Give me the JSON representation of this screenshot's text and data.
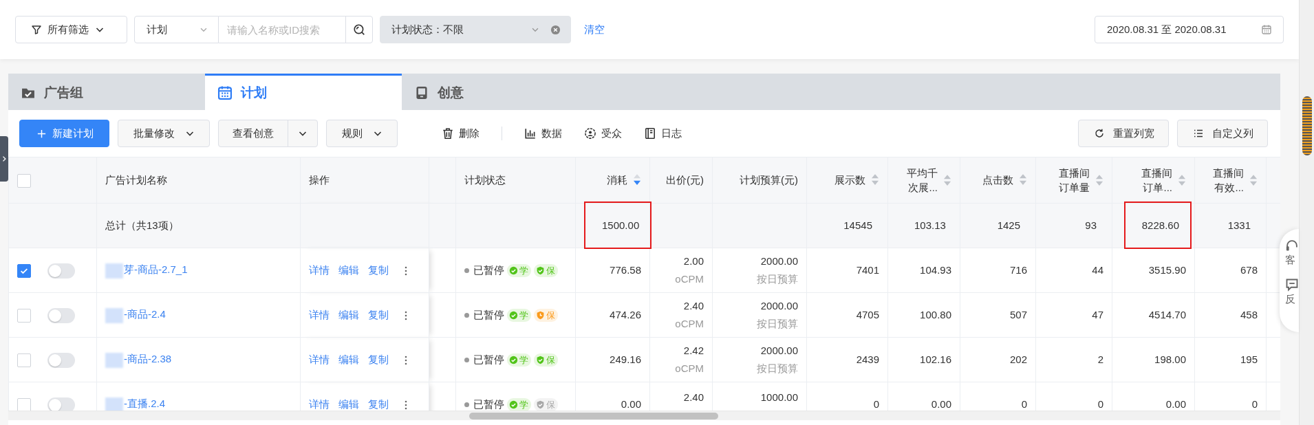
{
  "filters": {
    "scope": "所有筛选",
    "type": "计划",
    "search_placeholder": "请输入名称或ID搜索",
    "status": "计划状态：不限",
    "clear": "清空",
    "date_range": "2020.08.31 至 2020.08.31"
  },
  "tabs": [
    {
      "label": "广告组",
      "selected": false
    },
    {
      "label": "计划",
      "selected": true
    },
    {
      "label": "创意",
      "selected": false
    }
  ],
  "toolbar": {
    "buttons": [
      {
        "label": "新建计划",
        "kind": "primary"
      },
      {
        "label": "批量修改",
        "kind": "dropdown"
      },
      {
        "label": "查看创意",
        "kind": "split"
      },
      {
        "label": "规则",
        "kind": "dropdown"
      }
    ],
    "actions": [
      "删除",
      "数据",
      "受众",
      "日志"
    ],
    "right_buttons": [
      "重置列宽",
      "自定义列"
    ]
  },
  "table": {
    "header_checkbox": {
      "checked": false
    },
    "columns": [
      {
        "lines": [
          "广告计划名称"
        ],
        "sortable": false
      },
      {
        "lines": [
          "操作"
        ],
        "sortable": false
      },
      {
        "lines": [
          "计划状态"
        ],
        "sortable": false
      },
      {
        "lines": [
          "消耗"
        ],
        "sortable": true,
        "sorted_desc": true
      },
      {
        "lines": [
          "出价(元)"
        ],
        "sortable": false
      },
      {
        "lines": [
          "计划预算(元)"
        ],
        "sortable": false
      },
      {
        "lines": [
          "展示数"
        ],
        "sortable": true,
        "sorted_desc": false
      },
      {
        "lines": [
          "平均千",
          "次展..."
        ],
        "sortable": true,
        "sorted_desc": false
      },
      {
        "lines": [
          "点击数"
        ],
        "sortable": true,
        "sorted_desc": false
      },
      {
        "lines": [
          "直播间",
          "订单量"
        ],
        "sortable": true,
        "sorted_desc": false
      },
      {
        "lines": [
          "直播间",
          "订单..."
        ],
        "sortable": true,
        "sorted_desc": false
      },
      {
        "lines": [
          "直播间",
          "有效..."
        ],
        "sortable": true,
        "sorted_desc": false
      }
    ],
    "totals": {
      "label": "总计（共13项）",
      "cells": [
        {
          "value": "1500.00",
          "highlighted": true
        },
        null,
        null,
        {
          "value": "14545",
          "highlighted": false
        },
        {
          "value": "103.13",
          "highlighted": false
        },
        {
          "value": "1425",
          "highlighted": false
        },
        {
          "value": "93",
          "highlighted": false
        },
        {
          "value": "8228.60",
          "highlighted": true
        },
        {
          "value": "1331",
          "highlighted": false
        }
      ]
    },
    "rows": [
      {
        "checked": true,
        "on": false,
        "name": "芽-商品-2.7_1",
        "actions": [
          "详情",
          "编辑",
          "复制"
        ],
        "status": "已暂停",
        "badges": [
          {
            "label": "学",
            "color": "#52c41a"
          },
          {
            "label": "保",
            "color": "#52c41a"
          }
        ],
        "spend": "776.58",
        "bid": "2.00",
        "bid_mode": "oCPM",
        "budget": "2000.00",
        "budget_type": "按日预算",
        "metrics": [
          "7401",
          "104.93",
          "716",
          "44",
          "3515.90",
          "678"
        ]
      },
      {
        "checked": false,
        "on": false,
        "name": "-商品-2.4",
        "actions": [
          "详情",
          "编辑",
          "复制"
        ],
        "status": "已暂停",
        "badges": [
          {
            "label": "学",
            "color": "#52c41a"
          },
          {
            "label": "保",
            "color": "#fa9a1c"
          }
        ],
        "spend": "474.26",
        "bid": "2.40",
        "bid_mode": "oCPM",
        "budget": "2000.00",
        "budget_type": "按日预算",
        "metrics": [
          "4705",
          "100.80",
          "507",
          "47",
          "4514.70",
          "458"
        ]
      },
      {
        "checked": false,
        "on": false,
        "name": "-商品-2.38",
        "actions": [
          "详情",
          "编辑",
          "复制"
        ],
        "status": "已暂停",
        "badges": [
          {
            "label": "学",
            "color": "#52c41a"
          },
          {
            "label": "保",
            "color": "#52c41a"
          }
        ],
        "spend": "249.16",
        "bid": "2.42",
        "bid_mode": "oCPM",
        "budget": "2000.00",
        "budget_type": "按日预算",
        "metrics": [
          "2439",
          "102.16",
          "202",
          "2",
          "198.00",
          "195"
        ]
      },
      {
        "checked": false,
        "on": false,
        "name": "-直播.2.4",
        "actions": [
          "详情",
          "编辑",
          "复制"
        ],
        "status": "已暂停",
        "badges": [
          {
            "label": "学",
            "color": "#52c41a"
          },
          {
            "label": "保",
            "color": "#a8a8a8"
          }
        ],
        "spend": "0.00",
        "bid": "2.40",
        "budget": "1000.00",
        "metrics": [
          "0",
          "0.00",
          "0",
          "0",
          "0.00",
          "0"
        ]
      }
    ]
  },
  "side_widget": [
    "客",
    "反"
  ]
}
